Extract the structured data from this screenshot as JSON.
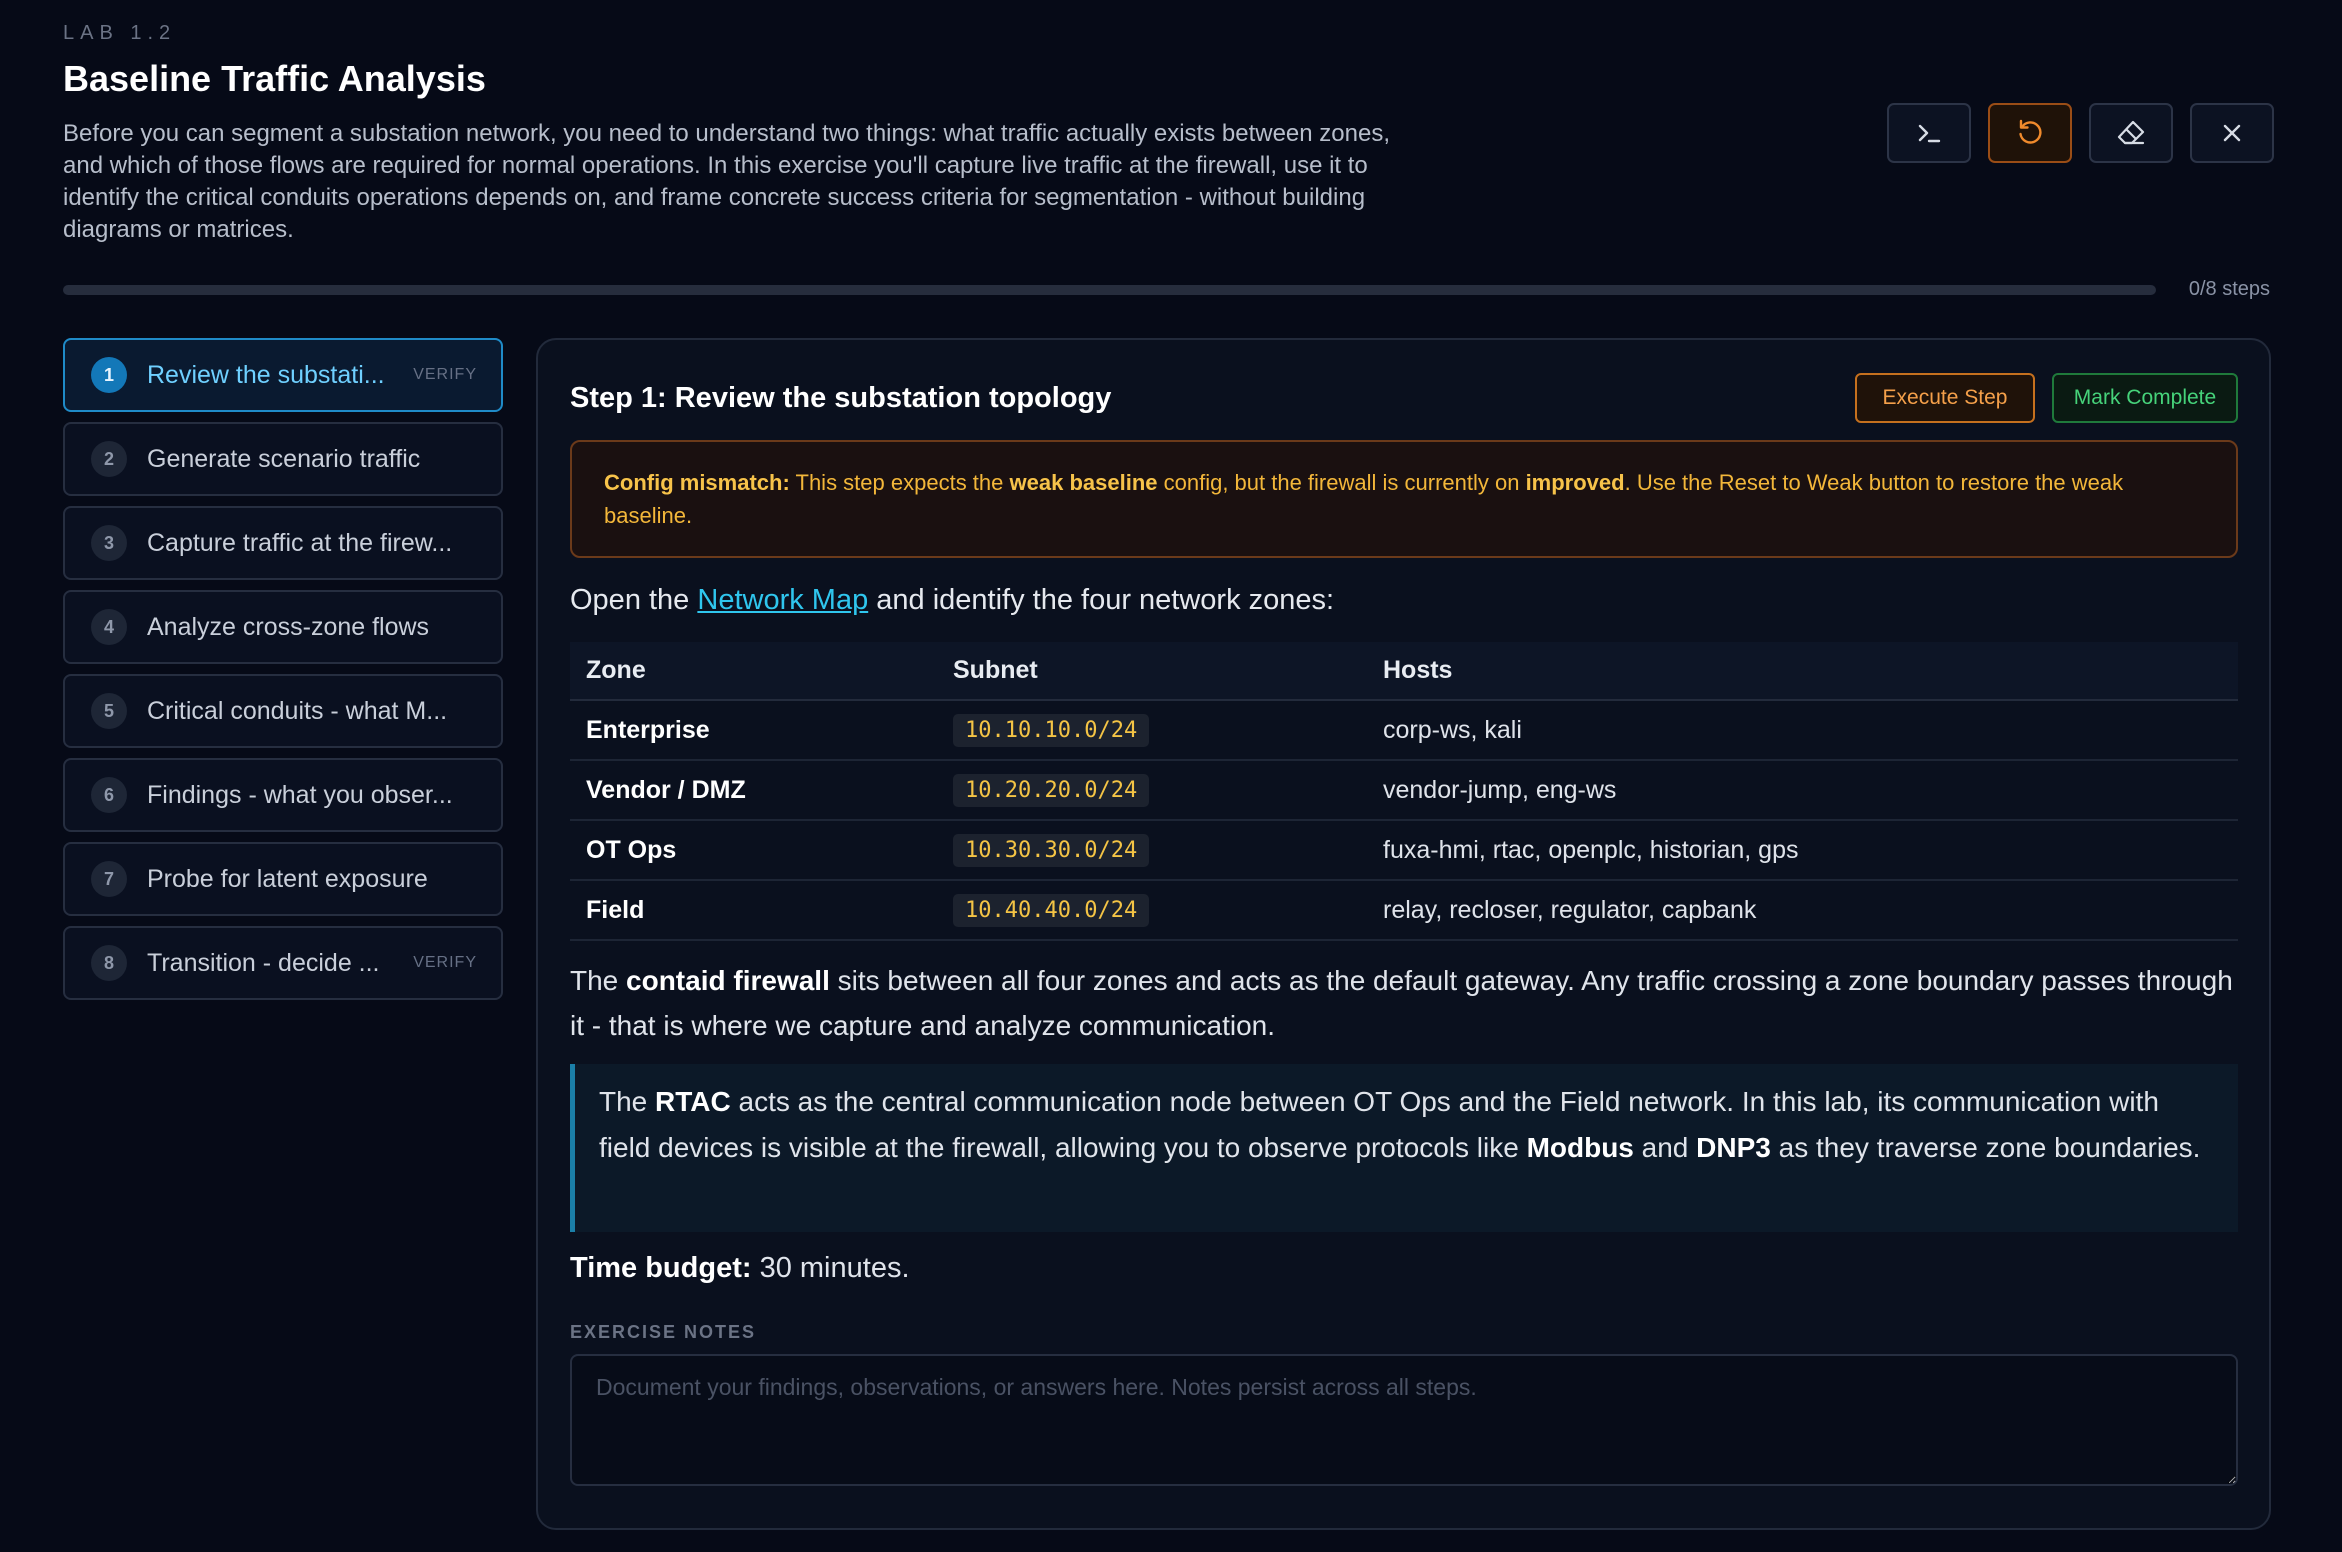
{
  "header": {
    "eyebrow": "LAB 1.2",
    "title": "Baseline Traffic Analysis",
    "description": "Before you can segment a substation network, you need to understand two things: what traffic actually exists between zones, and which of those flows are required for normal operations. In this exercise you'll capture live traffic at the firewall, use it to identify the critical conduits operations depends on, and frame concrete success criteria for segmentation - without building diagrams or matrices."
  },
  "toolbar": {
    "icons": [
      "terminal-icon",
      "reset-icon",
      "eraser-icon",
      "close-icon"
    ]
  },
  "progress": {
    "label": "0/8 steps",
    "completed": 0,
    "total": 8
  },
  "steps": [
    {
      "num": "1",
      "label": "Review the substati...",
      "badge": "VERIFY",
      "active": true
    },
    {
      "num": "2",
      "label": "Generate scenario traffic",
      "badge": ""
    },
    {
      "num": "3",
      "label": "Capture traffic at the firew...",
      "badge": ""
    },
    {
      "num": "4",
      "label": "Analyze cross-zone flows",
      "badge": ""
    },
    {
      "num": "5",
      "label": "Critical conduits - what M...",
      "badge": ""
    },
    {
      "num": "6",
      "label": "Findings - what you obser...",
      "badge": ""
    },
    {
      "num": "7",
      "label": "Probe for latent exposure",
      "badge": ""
    },
    {
      "num": "8",
      "label": "Transition - decide ...",
      "badge": "VERIFY"
    }
  ],
  "card": {
    "title": "Step 1: Review the substation topology",
    "execute_label": "Execute Step",
    "mark_label": "Mark Complete",
    "alert": {
      "lead": "Config mismatch:",
      "t1": " This step expects the ",
      "b1": "weak baseline",
      "t2": " config, but the firewall is currently on ",
      "b2": "improved",
      "t3": ". Use the Reset to Weak button to restore the weak baseline."
    },
    "intro": {
      "pre": "Open the ",
      "link": "Network Map",
      "post": " and identify the four network zones:"
    },
    "table": {
      "headers": [
        "Zone",
        "Subnet",
        "Hosts"
      ],
      "rows": [
        {
          "zone": "Enterprise",
          "subnet": "10.10.10.0/24",
          "hosts": "corp-ws, kali"
        },
        {
          "zone": "Vendor / DMZ",
          "subnet": "10.20.20.0/24",
          "hosts": "vendor-jump, eng-ws"
        },
        {
          "zone": "OT Ops",
          "subnet": "10.30.30.0/24",
          "hosts": "fuxa-hmi, rtac, openplc, historian, gps"
        },
        {
          "zone": "Field",
          "subnet": "10.40.40.0/24",
          "hosts": "relay, recloser, regulator, capbank"
        }
      ]
    },
    "para": {
      "pre": "The ",
      "bold": "contaid firewall",
      "post": " sits between all four zones and acts as the default gateway. Any traffic crossing a zone boundary passes through it - that is where we capture and analyze communication."
    },
    "quote": {
      "t1": "The ",
      "b1": "RTAC",
      "t2": " acts as the central communication node between OT Ops and the Field network. In this lab, its communication with field devices is visible at the firewall, allowing you to observe protocols like ",
      "b2": "Modbus",
      "t3": " and ",
      "b3": "DNP3",
      "t4": " as they traverse zone boundaries."
    },
    "budget": {
      "label": "Time budget:",
      "value": " 30 minutes."
    },
    "notes": {
      "label": "EXERCISE NOTES",
      "placeholder": "Document your findings, observations, or answers here. Notes persist across all steps.",
      "value": ""
    }
  },
  "colors": {
    "accent": "#22a5d6",
    "warning": "#f5a04a",
    "success": "#46d37a",
    "code": "#f4c445"
  }
}
